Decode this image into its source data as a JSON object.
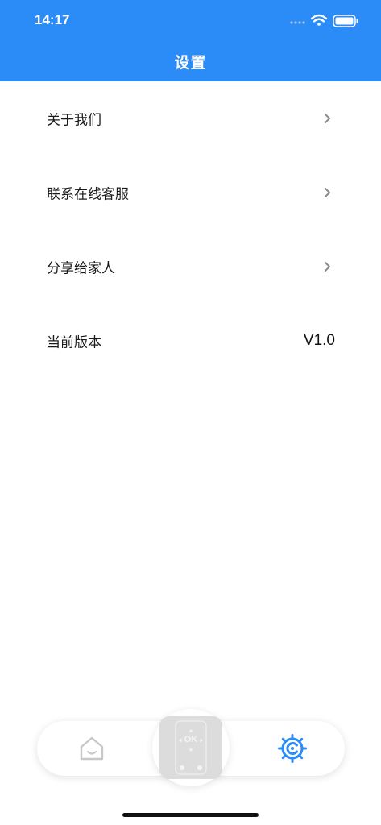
{
  "status_bar": {
    "time": "14:17"
  },
  "header": {
    "title": "设置"
  },
  "settings": {
    "items": [
      {
        "label": "关于我们",
        "icon": "chevron-right-icon"
      },
      {
        "label": "联系在线客服",
        "icon": "chevron-right-icon"
      },
      {
        "label": "分享给家人",
        "icon": "chevron-right-icon"
      },
      {
        "label": "当前版本",
        "value": "V1.0"
      }
    ]
  },
  "tabbar": {
    "tabs": [
      {
        "name": "home",
        "icon": "home-icon",
        "active": false
      },
      {
        "name": "remote",
        "icon": "remote-control-icon",
        "center_text": "OK",
        "active": false
      },
      {
        "name": "settings",
        "icon": "gear-icon",
        "active": true
      }
    ]
  },
  "colors": {
    "header_bg": "#2b8bf7",
    "active_tab": "#2b8bf7",
    "inactive_tab": "#c8c8c8",
    "text": "#1a1a1a"
  }
}
